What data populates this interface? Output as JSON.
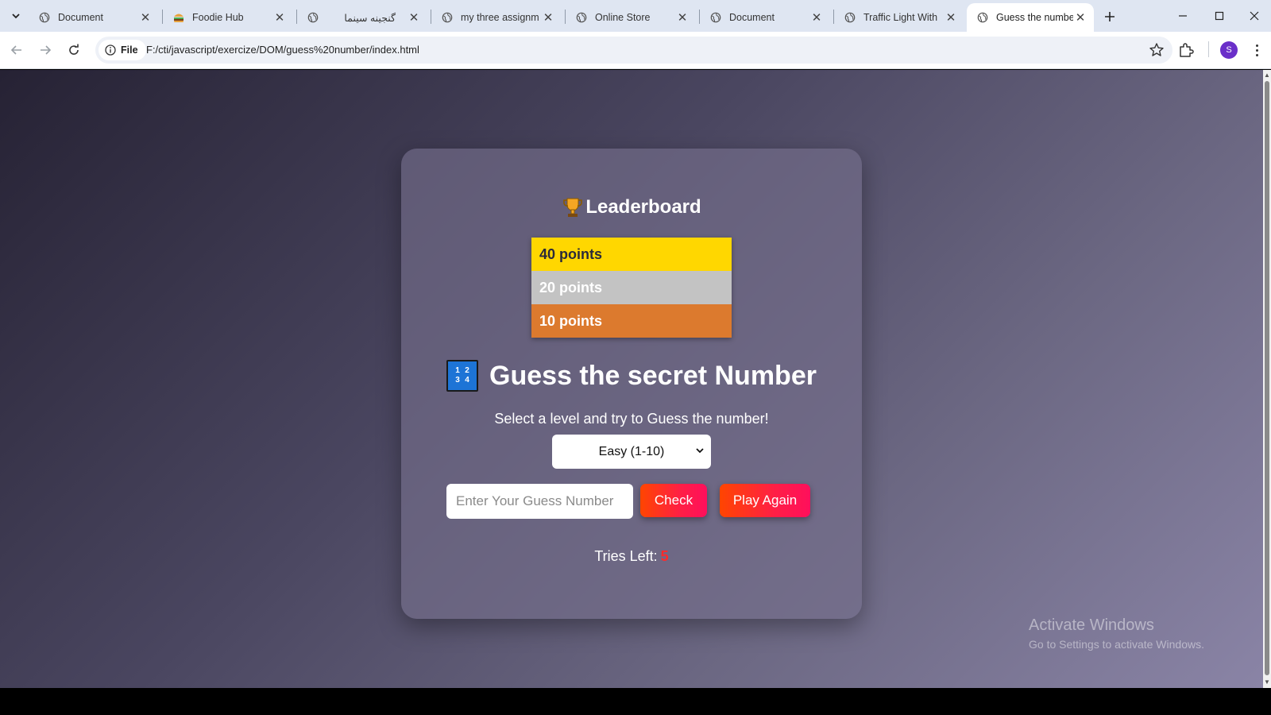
{
  "tabs": [
    {
      "title": "Document",
      "favicon": "globe-icon"
    },
    {
      "title": "Foodie Hub",
      "favicon": "burger-icon"
    },
    {
      "title": "گنجینه سینما",
      "favicon": "globe-icon"
    },
    {
      "title": "my three assignm",
      "favicon": "globe-icon"
    },
    {
      "title": "Online Store",
      "favicon": "globe-icon"
    },
    {
      "title": "Document",
      "favicon": "globe-icon"
    },
    {
      "title": "Traffic Light With",
      "favicon": "globe-icon"
    },
    {
      "title": "Guess the number",
      "favicon": "globe-icon",
      "active": true
    }
  ],
  "toolbar": {
    "chip_label": "File",
    "url": "F:/cti/javascript/exercize/DOM/guess%20number/index.html",
    "profile_initial": "S"
  },
  "page": {
    "leaderboard_title": "Leaderboard",
    "leaderboard": [
      "40 points",
      "20 points",
      "10 points"
    ],
    "heading": "Guess the secret Number",
    "number_icon": [
      "1",
      "2",
      "3",
      "4"
    ],
    "subtitle": "Select a level and try to Guess the number!",
    "level_selected": "Easy (1-10)",
    "guess_placeholder": "Enter Your Guess Number",
    "check_label": "Check",
    "play_again_label": "Play Again",
    "tries_label": "Tries Left:",
    "tries_count": "5"
  },
  "watermark": {
    "line1": "Activate Windows",
    "line2": "Go to Settings to activate Windows."
  },
  "colors": {
    "gold": "#ffd700",
    "silver": "#c3c3c3",
    "bronze": "#dc7a2e",
    "button_gradient_start": "#ff4500",
    "button_gradient_end": "#ff0f5c",
    "tries_count": "#ff2a2a"
  }
}
